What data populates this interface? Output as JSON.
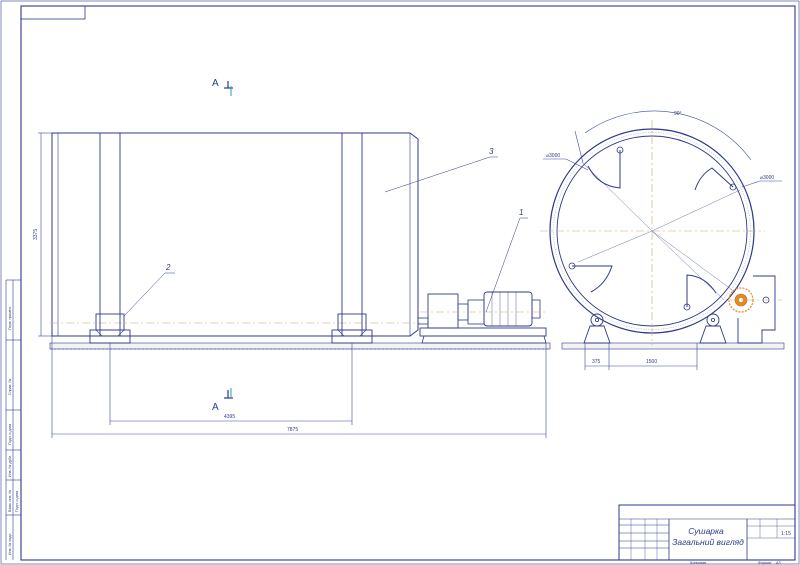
{
  "section": {
    "marker": "A"
  },
  "drum_view": {
    "height_dim": "3375",
    "bearing_span_dim": "4395",
    "overall_length_dim": "7875",
    "callouts": [
      "1",
      "2",
      "3"
    ]
  },
  "section_view": {
    "angle_dim": "90°",
    "inner_diameter": "⌀3000",
    "outer_diameter": "⌀3000",
    "offset_dim": "375",
    "support_span_dim": "1500"
  },
  "title_block": {
    "title_line1": "Сушарка",
    "title_line2": "Загальний вигляд",
    "scale": "1:15",
    "copied_by": "Копіював",
    "format": "Формат",
    "format_value": "А3"
  },
  "side_stamp": {
    "cells": [
      "Перв. примен.",
      "Справ. №",
      "Подп. и дата",
      "Инв. № дубл.",
      "Взам. инв. №",
      "Подп. и дата",
      "Инв. № подл."
    ]
  },
  "colors": {
    "line": "#2d3a8a",
    "axis": "#c9a86a",
    "accent": "#e08a2a"
  }
}
